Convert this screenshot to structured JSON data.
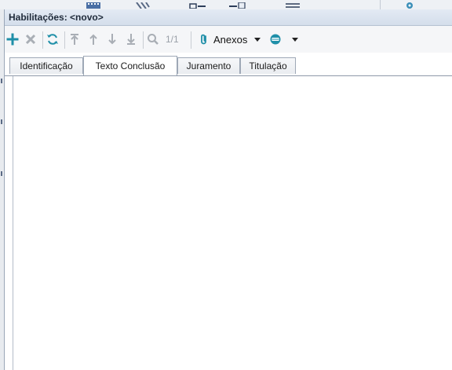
{
  "window": {
    "title": "Habilitações: <novo>"
  },
  "toolbar": {
    "buttons": [
      {
        "name": "add",
        "icon": "plus-icon",
        "enabled": true
      },
      {
        "name": "delete",
        "icon": "x-icon",
        "enabled": false
      },
      {
        "name": "refresh",
        "icon": "refresh-icon",
        "enabled": true
      },
      {
        "name": "first",
        "icon": "arrow-to-top-icon",
        "enabled": false
      },
      {
        "name": "previous",
        "icon": "arrow-up-icon",
        "enabled": false
      },
      {
        "name": "next",
        "icon": "arrow-down-icon",
        "enabled": false
      },
      {
        "name": "last",
        "icon": "arrow-to-bottom-icon",
        "enabled": false
      },
      {
        "name": "search",
        "icon": "magnifier-icon",
        "enabled": false
      }
    ],
    "page_indicator": "1/1",
    "attachments_label": "Anexos",
    "colors": {
      "accent": "#1f8fa8",
      "disabled": "#a9aeb5"
    }
  },
  "tabs": [
    {
      "label": "Identificação",
      "active": false
    },
    {
      "label": "Texto Conclusão",
      "active": true
    },
    {
      "label": "Juramento",
      "active": false
    },
    {
      "label": "Titulação",
      "active": false
    }
  ]
}
